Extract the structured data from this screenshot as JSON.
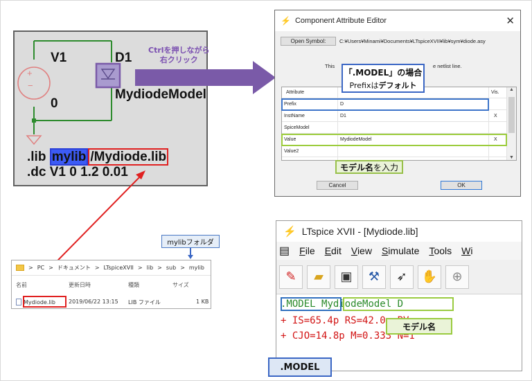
{
  "schematic": {
    "v1": "V1",
    "zero": "0",
    "d1": "D1",
    "model": "MydiodeModel",
    "lib_prefix": ".lib",
    "lib_folder": "mylib",
    "lib_file": "/Mydiode.lib",
    "dc": ".dc V1 0 1.2 0.01",
    "plus": "+",
    "minus": "−"
  },
  "callout_ctrl": {
    "line1": "Ctrlを押しながら",
    "line2": "右クリック"
  },
  "editor": {
    "title": "Component Attribute Editor",
    "open_symbol": "Open Symbol:",
    "path": "C:¥Users¥Minami¥Documents¥LTspiceXVII¥lib¥sym¥diode.asy",
    "info_left": "This",
    "info_right": "e netlist line.",
    "col_attribute": "Attribute",
    "col_vis": "Vis.",
    "rows": [
      {
        "attr": "Prefix",
        "value": "D",
        "vis": ""
      },
      {
        "attr": "InstName",
        "value": "D1",
        "vis": "X"
      },
      {
        "attr": "SpiceModel",
        "value": "",
        "vis": ""
      },
      {
        "attr": "Value",
        "value": "MydiodeModel",
        "vis": "X"
      },
      {
        "attr": "Value2",
        "value": "",
        "vis": ""
      }
    ],
    "cancel": "Cancel",
    "ok": "OK"
  },
  "badge_model": {
    "line1": "「.MODEL」の場合",
    "line2_a": "Prefixは",
    "line2_b": "デフォルト"
  },
  "badge_input": {
    "a": "モデル名",
    "b": "を入力"
  },
  "explorer": {
    "crumbs": [
      ">",
      "PC",
      ">",
      "ドキュメント",
      ">",
      "LTspiceXVII",
      ">",
      "lib",
      ">",
      "sub",
      ">",
      "mylib"
    ],
    "headers": [
      "名前",
      "更新日時",
      "種類",
      "サイズ"
    ],
    "file": {
      "name": "Mydiode.lib",
      "date": "2019/06/22 13:15",
      "type": "LIB ファイル",
      "size": "1 KB"
    }
  },
  "mylib_badge": "mylibフォルダ",
  "ltspice": {
    "title": "LTspice XVII - [Mydiode.lib]",
    "menu": [
      "File",
      "Edit",
      "View",
      "Simulate",
      "Tools",
      "Wi"
    ],
    "menu_first": [
      "F",
      "E",
      "V",
      "S",
      "T",
      "W"
    ],
    "menu_rest": [
      "ile",
      "dit",
      "iew",
      "imulate",
      "ools",
      "i"
    ],
    "code_model": ".MODEL",
    "code_name": "MydiodeModel",
    "code_d": "D",
    "line2": "+  IS=65.4p  RS=42.0m BV=",
    "line3": "+  CJO=14.8p  M=0.333 N=1"
  },
  "badge_modelname": "モデル名",
  "badge_dotmodel": ".MODEL",
  "colors": {
    "purple": "#7a5aa8",
    "red": "#e02020",
    "blue": "#3a66c4",
    "green": "#9acb40"
  }
}
